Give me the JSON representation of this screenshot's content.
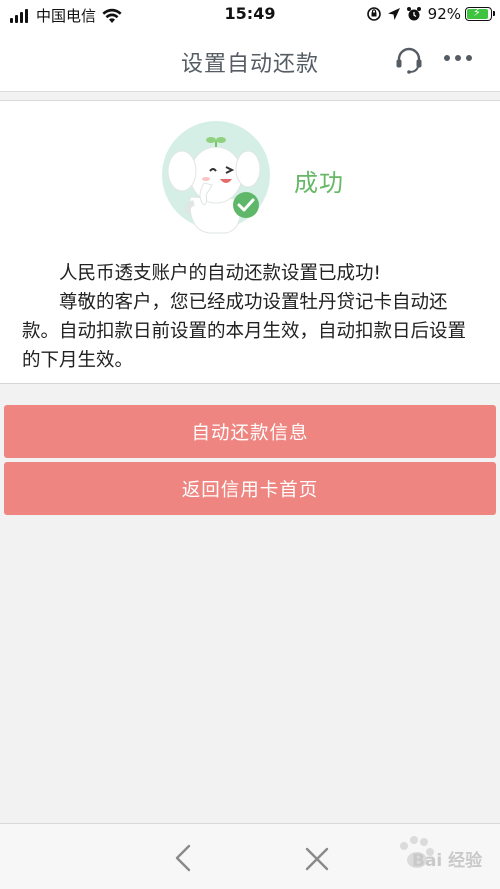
{
  "status_bar": {
    "carrier": "中国电信",
    "time": "15:49",
    "battery": "92%",
    "battery_level": 0.92
  },
  "header": {
    "title": "设置自动还款"
  },
  "result": {
    "status": "成功",
    "line1": "人民币透支账户的自动还款设置已成功!",
    "line2": "尊敬的客户，您已经成功设置牡丹贷记卡自动还款。自动扣款日前设置的本月生效，自动扣款日后设置的下月生效。"
  },
  "buttons": {
    "info": "自动还款信息",
    "back_to_card": "返回信用卡首页"
  },
  "watermark": {
    "text": "Bai 经验"
  },
  "colors": {
    "accent_button": "#ee8580",
    "success_green": "#66b866",
    "title_gray": "#555c63"
  }
}
